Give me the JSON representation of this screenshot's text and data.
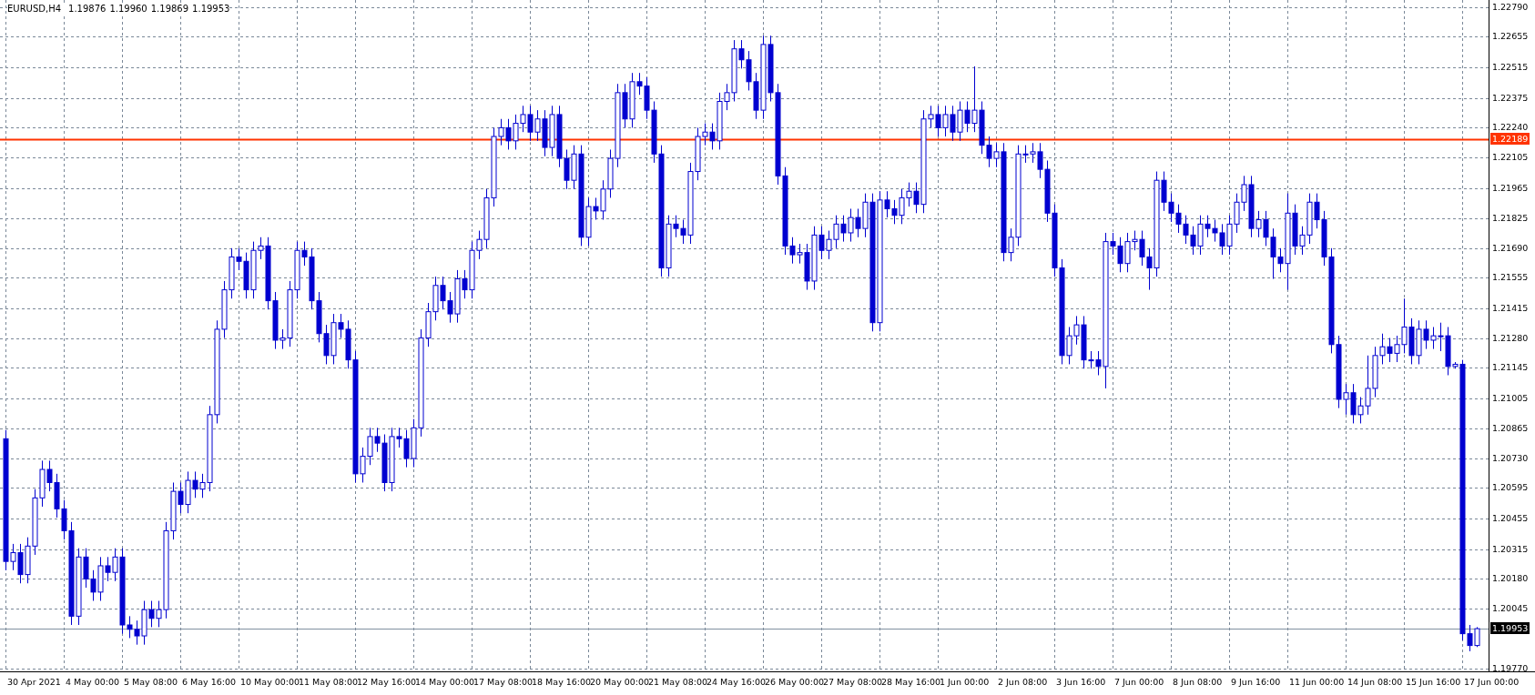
{
  "chart": {
    "quote": [
      "1.19876",
      "1.19960",
      "1.19869",
      "1.19953"
    ],
    "chart_data": {
      "type": "line",
      "title": "EURUSD,H4",
      "ylim": [
        1.19754,
        1.22823
      ],
      "grid": true,
      "yticks": [
        {
          "value": 1.2279,
          "label": "1.22790"
        },
        {
          "value": 1.22655,
          "label": "1.22655"
        },
        {
          "value": 1.22515,
          "label": "1.22515"
        },
        {
          "value": 1.22375,
          "label": "1.22375"
        },
        {
          "value": 1.2224,
          "label": "1.22240"
        },
        {
          "value": 1.22105,
          "label": "1.22105"
        },
        {
          "value": 1.21965,
          "label": "1.21965"
        },
        {
          "value": 1.21825,
          "label": "1.21825"
        },
        {
          "value": 1.2169,
          "label": "1.21690"
        },
        {
          "value": 1.21555,
          "label": "1.21555"
        },
        {
          "value": 1.21415,
          "label": "1.21415"
        },
        {
          "value": 1.2128,
          "label": "1.21280"
        },
        {
          "value": 1.21145,
          "label": "1.21145"
        },
        {
          "value": 1.21005,
          "label": "1.21005"
        },
        {
          "value": 1.20865,
          "label": "1.20865"
        },
        {
          "value": 1.2073,
          "label": "1.20730"
        },
        {
          "value": 1.20595,
          "label": "1.20595"
        },
        {
          "value": 1.20455,
          "label": "1.20455"
        },
        {
          "value": 1.20315,
          "label": "1.20315"
        },
        {
          "value": 1.2018,
          "label": "1.20180"
        },
        {
          "value": 1.20045,
          "label": "1.20045"
        },
        {
          "value": 1.1977,
          "label": "1.19770"
        }
      ],
      "categories": [
        "30 Apr 2021",
        null,
        null,
        null,
        null,
        null,
        null,
        null,
        "4 May 00:00",
        null,
        null,
        null,
        null,
        null,
        null,
        null,
        "5 May 08:00",
        null,
        null,
        null,
        null,
        null,
        null,
        null,
        "6 May 16:00",
        null,
        null,
        null,
        null,
        null,
        null,
        null,
        "10 May 00:00",
        null,
        null,
        null,
        null,
        null,
        null,
        null,
        "11 May 08:00",
        null,
        null,
        null,
        null,
        null,
        null,
        null,
        "12 May 16:00",
        null,
        null,
        null,
        null,
        null,
        null,
        null,
        "14 May 00:00",
        null,
        null,
        null,
        null,
        null,
        null,
        null,
        "17 May 08:00",
        null,
        null,
        null,
        null,
        null,
        null,
        null,
        "18 May 16:00",
        null,
        null,
        null,
        null,
        null,
        null,
        null,
        "20 May 00:00",
        null,
        null,
        null,
        null,
        null,
        null,
        null,
        "21 May 08:00",
        null,
        null,
        null,
        null,
        null,
        null,
        null,
        "24 May 16:00",
        null,
        null,
        null,
        null,
        null,
        null,
        null,
        "26 May 00:00",
        null,
        null,
        null,
        null,
        null,
        null,
        null,
        "27 May 08:00",
        null,
        null,
        null,
        null,
        null,
        null,
        null,
        "28 May 16:00",
        null,
        null,
        null,
        null,
        null,
        null,
        null,
        "1 Jun 00:00",
        null,
        null,
        null,
        null,
        null,
        null,
        null,
        "2 Jun 08:00",
        null,
        null,
        null,
        null,
        null,
        null,
        null,
        "3 Jun 16:00",
        null,
        null,
        null,
        null,
        null,
        null,
        null,
        "7 Jun 00:00",
        null,
        null,
        null,
        null,
        null,
        null,
        null,
        "8 Jun 08:00",
        null,
        null,
        null,
        null,
        null,
        null,
        null,
        "9 Jun 16:00",
        null,
        null,
        null,
        null,
        null,
        null,
        null,
        "11 Jun 00:00",
        null,
        null,
        null,
        null,
        null,
        null,
        null,
        "14 Jun 08:00",
        null,
        null,
        null,
        null,
        null,
        null,
        null,
        "15 Jun 16:00",
        null,
        null,
        null,
        null,
        null,
        null,
        null,
        "17 Jun 00:00",
        null,
        null
      ],
      "ref_lines": [
        {
          "axis": "y",
          "value": 1.22189,
          "label": "1.22189",
          "color": "#ff3300"
        },
        {
          "axis": "y",
          "value": 1.19953,
          "label": "1.19953",
          "color": "#8090a0"
        }
      ]
    }
  }
}
